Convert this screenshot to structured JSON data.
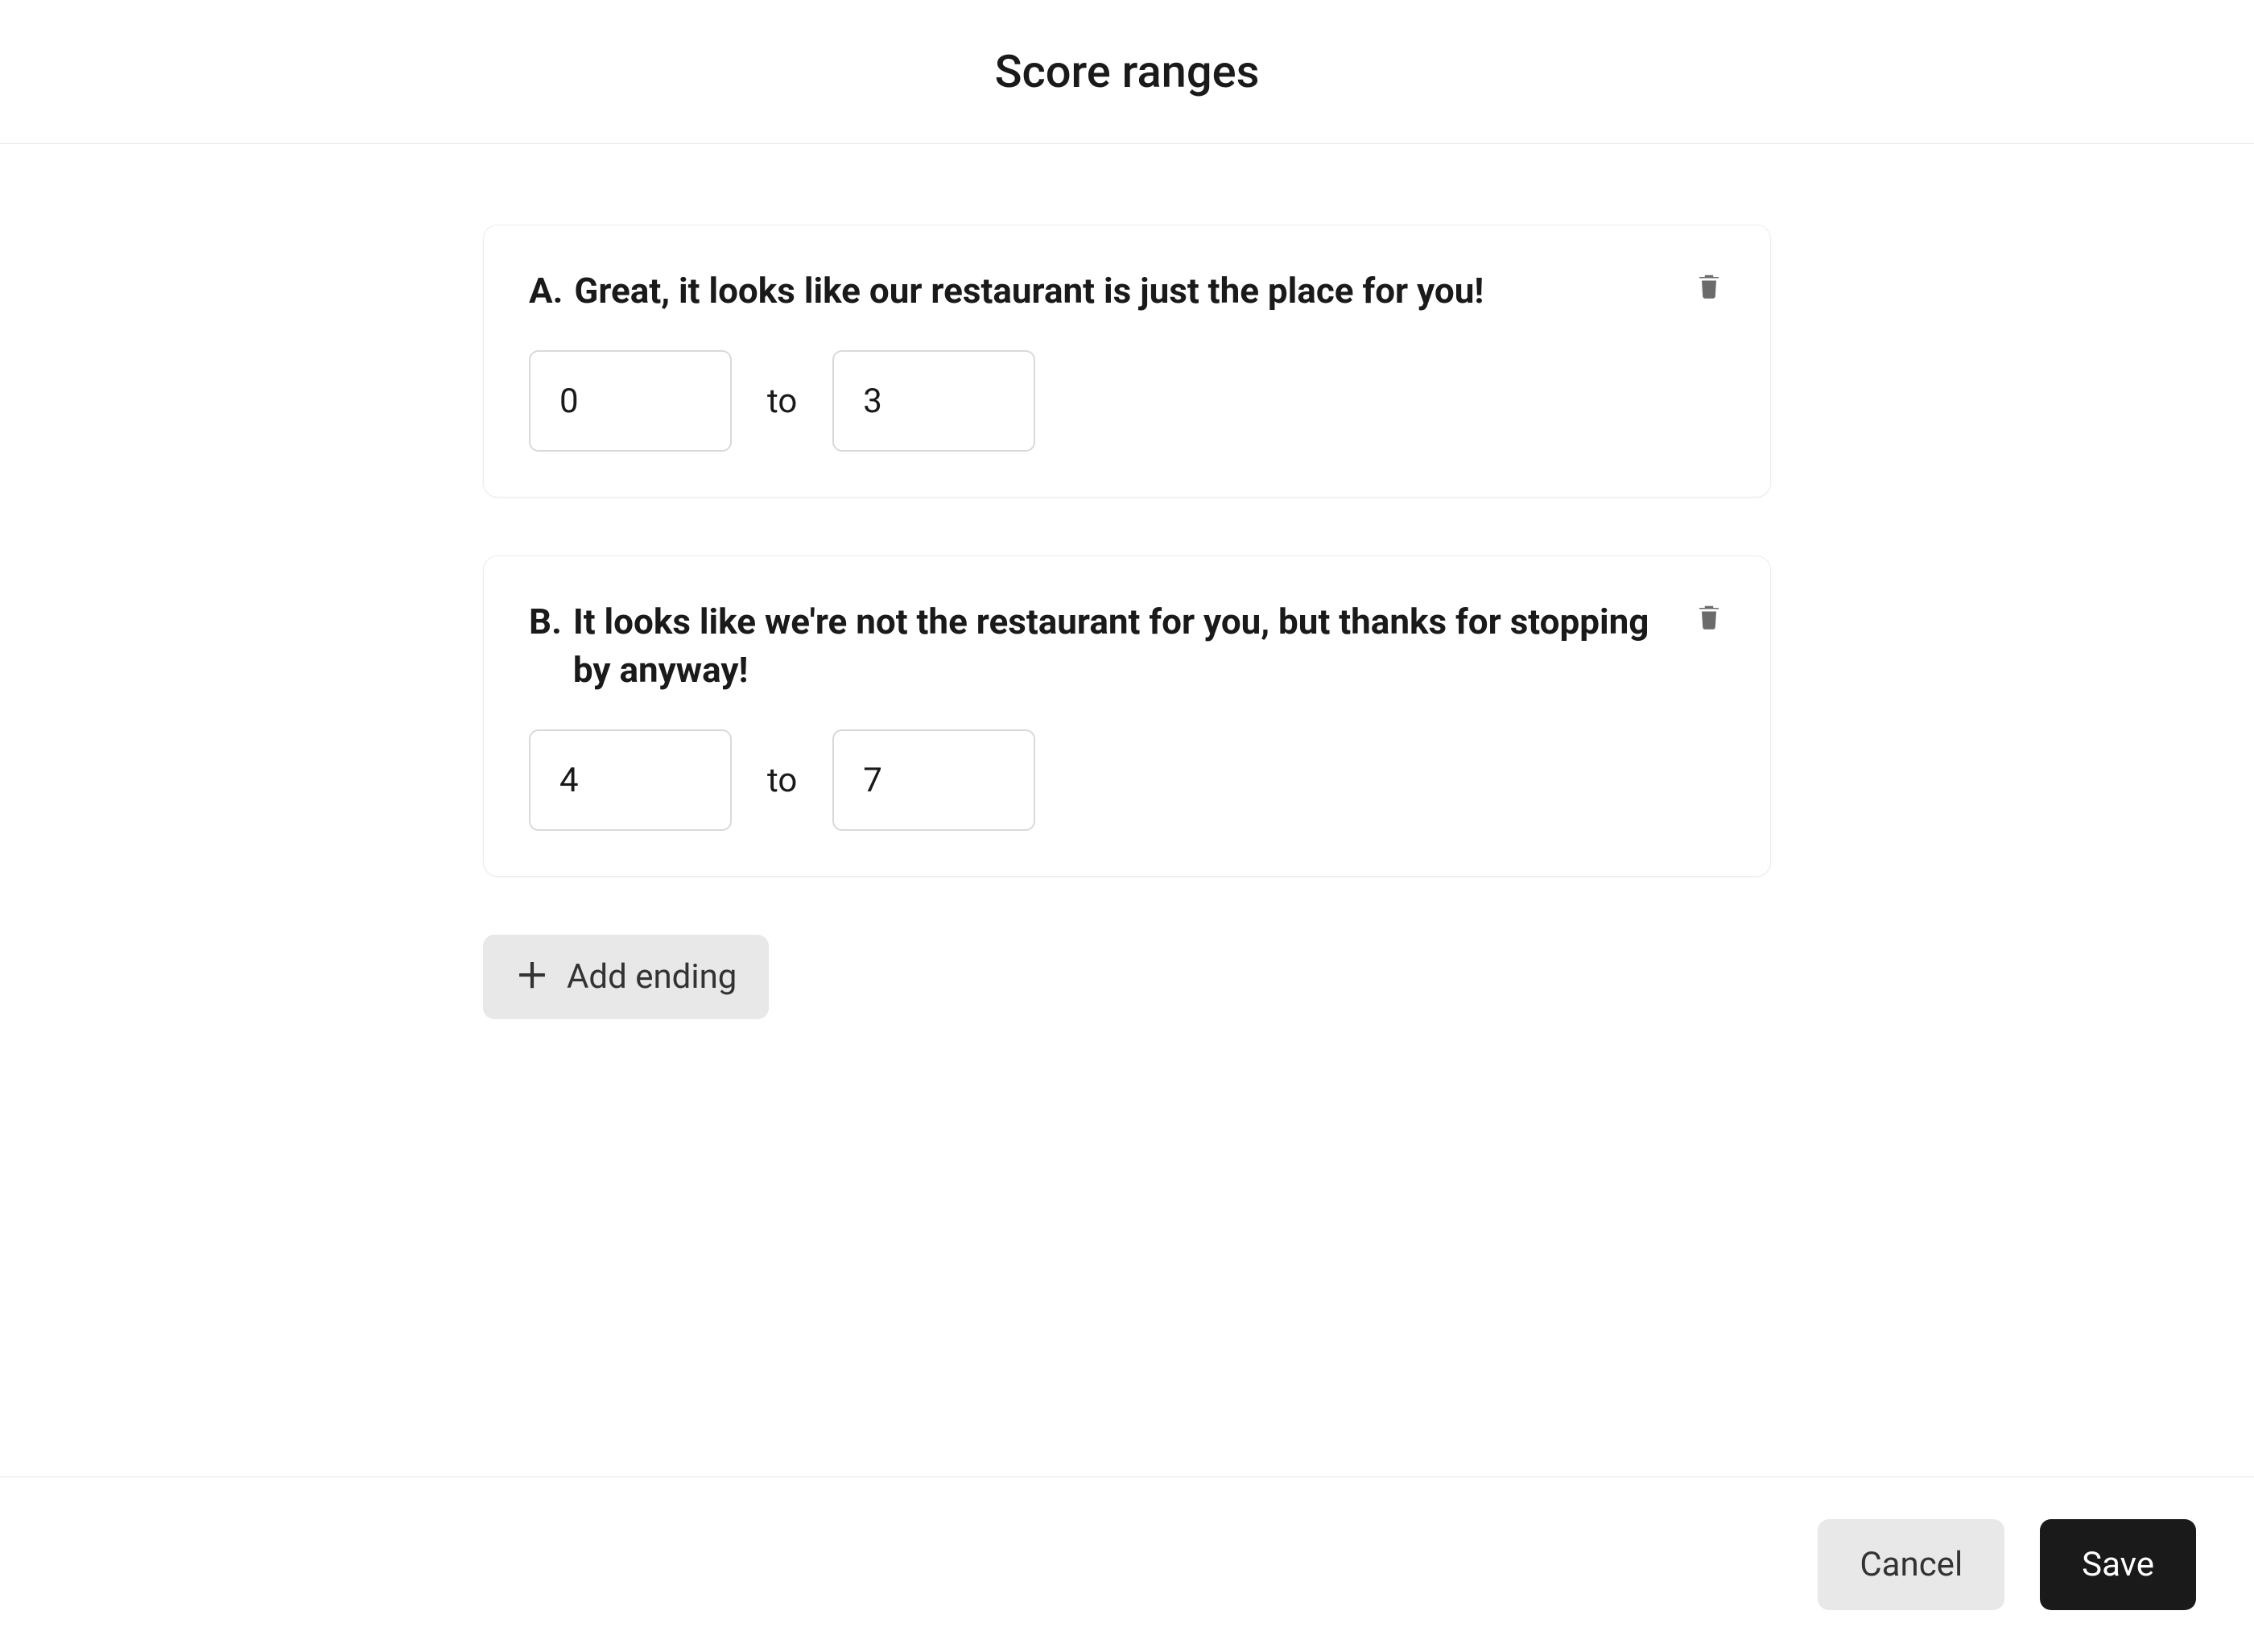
{
  "header": {
    "title": "Score ranges"
  },
  "endings": [
    {
      "letter": "A.",
      "title": "Great, it looks like our restaurant is just the place for you!",
      "from": "0",
      "to_label": "to",
      "to": "3"
    },
    {
      "letter": "B.",
      "title": "It looks like we're not the restaurant for you, but thanks for stopping by anyway!",
      "from": "4",
      "to_label": "to",
      "to": "7"
    }
  ],
  "actions": {
    "add_ending_label": "Add ending"
  },
  "footer": {
    "cancel_label": "Cancel",
    "save_label": "Save"
  }
}
